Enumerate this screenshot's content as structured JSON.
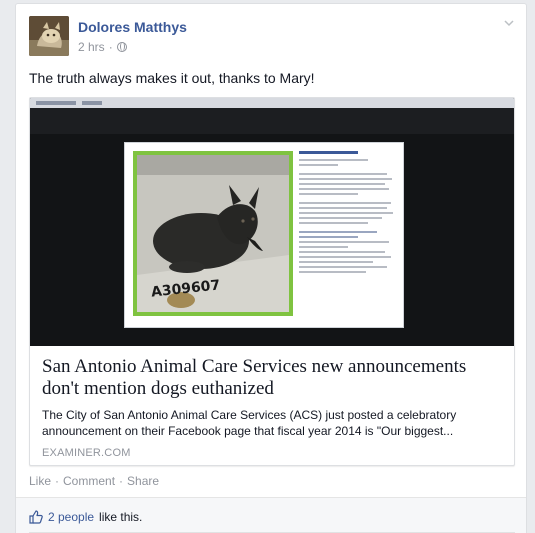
{
  "post": {
    "author": "Dolores Matthys",
    "time": "2 hrs",
    "separator": "·",
    "status_text": "The truth always makes it out, thanks to Mary!"
  },
  "link": {
    "title": "San Antonio Animal Care Services new announcements don't mention dogs euthanized",
    "description": "The City of San Antonio Animal Care Services (ACS) just posted a celebratory announcement on their Facebook page that fiscal year 2014 is \"Our biggest...",
    "domain": "EXAMINER.COM",
    "photo_tag": "A309607"
  },
  "actions": {
    "like": "Like",
    "comment": "Comment",
    "share": "Share",
    "sep": "·"
  },
  "likes": {
    "count": "2 people",
    "rest": "like this."
  },
  "colors": {
    "link_blue": "#3b5998",
    "muted": "#90949c",
    "photo_frame": "#7fc340"
  },
  "icons": [
    "chevron-down-icon",
    "globe-icon",
    "thumbs-up-icon"
  ]
}
